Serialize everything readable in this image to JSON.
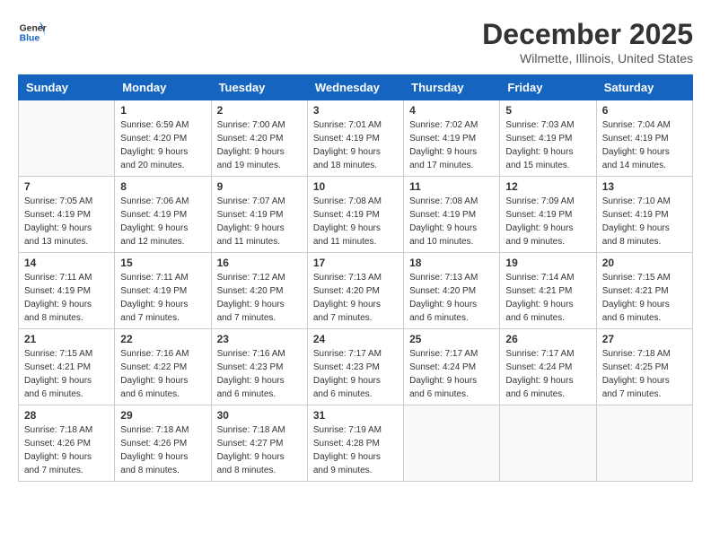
{
  "header": {
    "logo_general": "General",
    "logo_blue": "Blue",
    "month_title": "December 2025",
    "subtitle": "Wilmette, Illinois, United States"
  },
  "calendar": {
    "days_of_week": [
      "Sunday",
      "Monday",
      "Tuesday",
      "Wednesday",
      "Thursday",
      "Friday",
      "Saturday"
    ],
    "weeks": [
      [
        {
          "num": "",
          "info": ""
        },
        {
          "num": "1",
          "info": "Sunrise: 6:59 AM\nSunset: 4:20 PM\nDaylight: 9 hours\nand 20 minutes."
        },
        {
          "num": "2",
          "info": "Sunrise: 7:00 AM\nSunset: 4:20 PM\nDaylight: 9 hours\nand 19 minutes."
        },
        {
          "num": "3",
          "info": "Sunrise: 7:01 AM\nSunset: 4:19 PM\nDaylight: 9 hours\nand 18 minutes."
        },
        {
          "num": "4",
          "info": "Sunrise: 7:02 AM\nSunset: 4:19 PM\nDaylight: 9 hours\nand 17 minutes."
        },
        {
          "num": "5",
          "info": "Sunrise: 7:03 AM\nSunset: 4:19 PM\nDaylight: 9 hours\nand 15 minutes."
        },
        {
          "num": "6",
          "info": "Sunrise: 7:04 AM\nSunset: 4:19 PM\nDaylight: 9 hours\nand 14 minutes."
        }
      ],
      [
        {
          "num": "7",
          "info": "Sunrise: 7:05 AM\nSunset: 4:19 PM\nDaylight: 9 hours\nand 13 minutes."
        },
        {
          "num": "8",
          "info": "Sunrise: 7:06 AM\nSunset: 4:19 PM\nDaylight: 9 hours\nand 12 minutes."
        },
        {
          "num": "9",
          "info": "Sunrise: 7:07 AM\nSunset: 4:19 PM\nDaylight: 9 hours\nand 11 minutes."
        },
        {
          "num": "10",
          "info": "Sunrise: 7:08 AM\nSunset: 4:19 PM\nDaylight: 9 hours\nand 11 minutes."
        },
        {
          "num": "11",
          "info": "Sunrise: 7:08 AM\nSunset: 4:19 PM\nDaylight: 9 hours\nand 10 minutes."
        },
        {
          "num": "12",
          "info": "Sunrise: 7:09 AM\nSunset: 4:19 PM\nDaylight: 9 hours\nand 9 minutes."
        },
        {
          "num": "13",
          "info": "Sunrise: 7:10 AM\nSunset: 4:19 PM\nDaylight: 9 hours\nand 8 minutes."
        }
      ],
      [
        {
          "num": "14",
          "info": "Sunrise: 7:11 AM\nSunset: 4:19 PM\nDaylight: 9 hours\nand 8 minutes."
        },
        {
          "num": "15",
          "info": "Sunrise: 7:11 AM\nSunset: 4:19 PM\nDaylight: 9 hours\nand 7 minutes."
        },
        {
          "num": "16",
          "info": "Sunrise: 7:12 AM\nSunset: 4:20 PM\nDaylight: 9 hours\nand 7 minutes."
        },
        {
          "num": "17",
          "info": "Sunrise: 7:13 AM\nSunset: 4:20 PM\nDaylight: 9 hours\nand 7 minutes."
        },
        {
          "num": "18",
          "info": "Sunrise: 7:13 AM\nSunset: 4:20 PM\nDaylight: 9 hours\nand 6 minutes."
        },
        {
          "num": "19",
          "info": "Sunrise: 7:14 AM\nSunset: 4:21 PM\nDaylight: 9 hours\nand 6 minutes."
        },
        {
          "num": "20",
          "info": "Sunrise: 7:15 AM\nSunset: 4:21 PM\nDaylight: 9 hours\nand 6 minutes."
        }
      ],
      [
        {
          "num": "21",
          "info": "Sunrise: 7:15 AM\nSunset: 4:21 PM\nDaylight: 9 hours\nand 6 minutes."
        },
        {
          "num": "22",
          "info": "Sunrise: 7:16 AM\nSunset: 4:22 PM\nDaylight: 9 hours\nand 6 minutes."
        },
        {
          "num": "23",
          "info": "Sunrise: 7:16 AM\nSunset: 4:23 PM\nDaylight: 9 hours\nand 6 minutes."
        },
        {
          "num": "24",
          "info": "Sunrise: 7:17 AM\nSunset: 4:23 PM\nDaylight: 9 hours\nand 6 minutes."
        },
        {
          "num": "25",
          "info": "Sunrise: 7:17 AM\nSunset: 4:24 PM\nDaylight: 9 hours\nand 6 minutes."
        },
        {
          "num": "26",
          "info": "Sunrise: 7:17 AM\nSunset: 4:24 PM\nDaylight: 9 hours\nand 6 minutes."
        },
        {
          "num": "27",
          "info": "Sunrise: 7:18 AM\nSunset: 4:25 PM\nDaylight: 9 hours\nand 7 minutes."
        }
      ],
      [
        {
          "num": "28",
          "info": "Sunrise: 7:18 AM\nSunset: 4:26 PM\nDaylight: 9 hours\nand 7 minutes."
        },
        {
          "num": "29",
          "info": "Sunrise: 7:18 AM\nSunset: 4:26 PM\nDaylight: 9 hours\nand 8 minutes."
        },
        {
          "num": "30",
          "info": "Sunrise: 7:18 AM\nSunset: 4:27 PM\nDaylight: 9 hours\nand 8 minutes."
        },
        {
          "num": "31",
          "info": "Sunrise: 7:19 AM\nSunset: 4:28 PM\nDaylight: 9 hours\nand 9 minutes."
        },
        {
          "num": "",
          "info": ""
        },
        {
          "num": "",
          "info": ""
        },
        {
          "num": "",
          "info": ""
        }
      ]
    ]
  }
}
